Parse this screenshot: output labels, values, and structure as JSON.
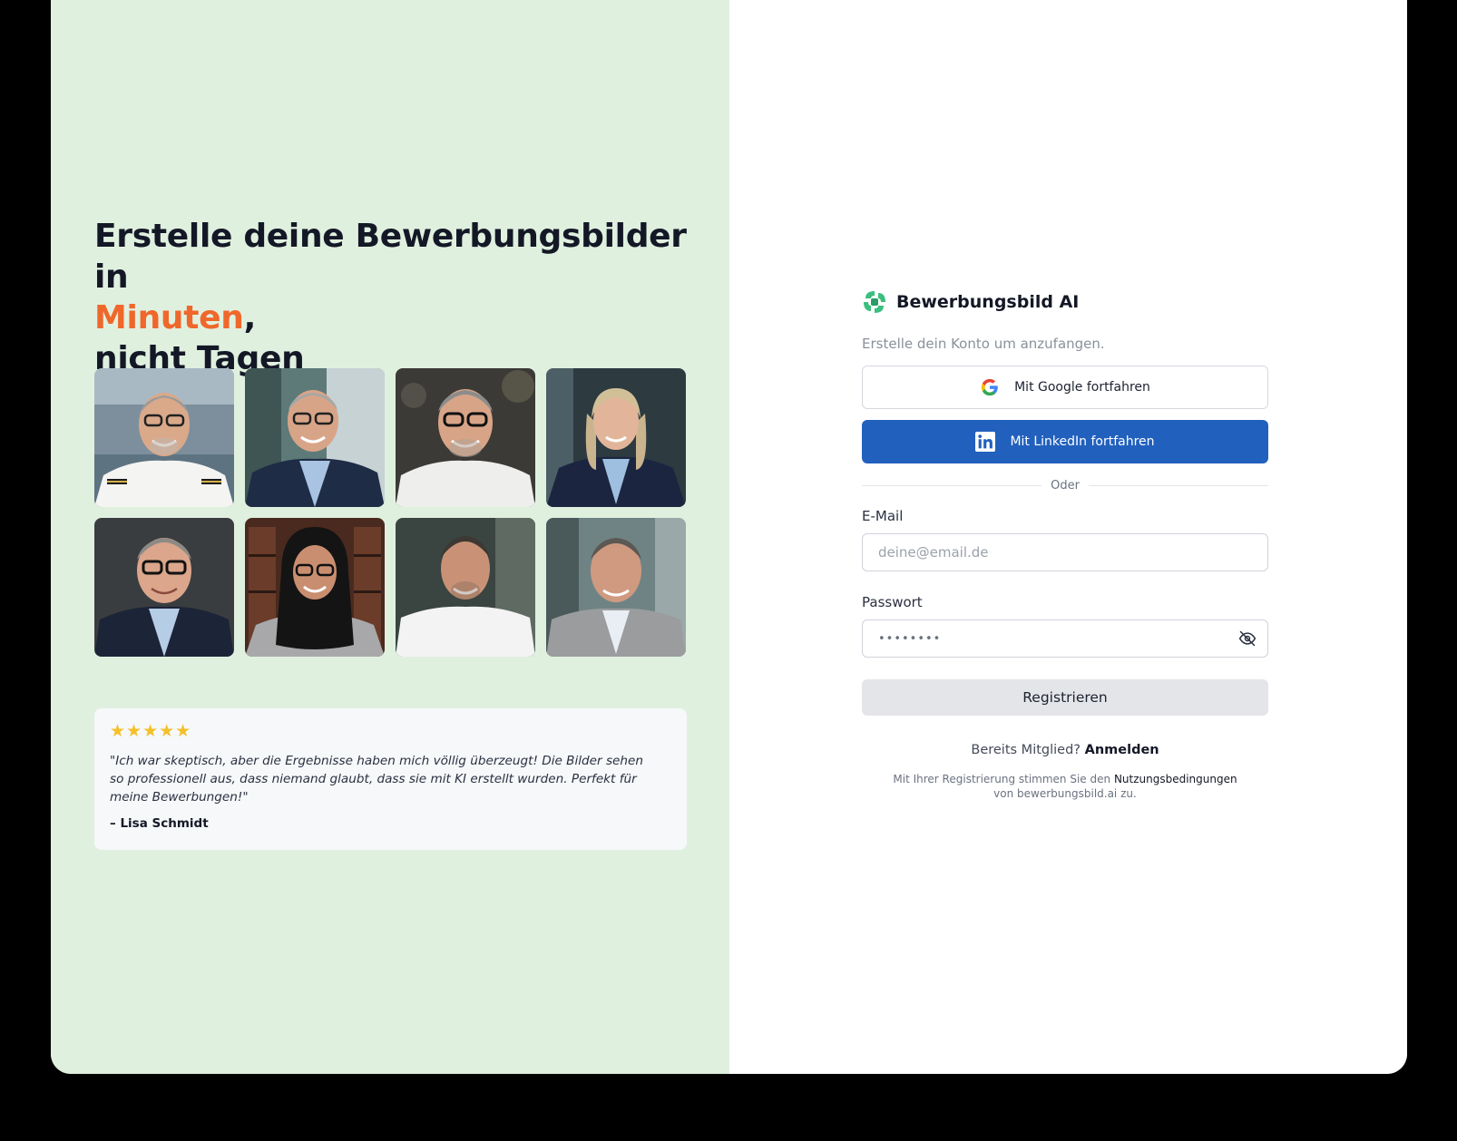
{
  "hero": {
    "headline_line1": "Erstelle deine Bewerbungsbilder in",
    "headline_accent": "Minuten",
    "headline_comma": ",",
    "headline_line3": "nicht Tagen",
    "accent_color": "#f0672b"
  },
  "review": {
    "rating": 5,
    "stars": "★★★★★",
    "quote": "\"Ich war skeptisch, aber die Ergebnisse haben mich völlig überzeugt! Die Bilder sehen so professionell aus, dass niemand glaubt, dass sie mit KI erstellt wurden. Perfekt für meine Bewerbungen!\"",
    "author": "– Lisa Schmidt"
  },
  "brand": {
    "name": "Bewerbungsbild AI",
    "logo_color": "#3bbf7e"
  },
  "form": {
    "subtitle": "Erstelle dein Konto um anzufangen.",
    "google_label": "Mit Google fortfahren",
    "linkedin_label": "Mit LinkedIn fortfahren",
    "linkedin_color": "#2160bd",
    "divider_label": "Oder",
    "email_label": "E-Mail",
    "email_placeholder": "deine@email.de",
    "email_value": "",
    "password_label": "Passwort",
    "password_value": "••••••••",
    "register_label": "Registrieren",
    "login_prompt": "Bereits Mitglied?",
    "login_link": "Anmelden",
    "terms_prefix": "Mit Ihrer Registrierung stimmen Sie den",
    "terms_link": "Nutzungsbedingungen",
    "terms_suffix": "von bewerbungsbild.ai zu."
  }
}
